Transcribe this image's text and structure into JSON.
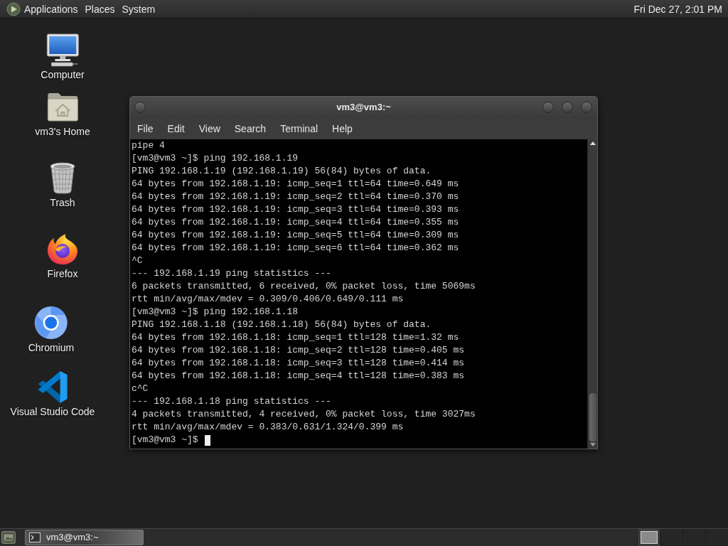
{
  "top_panel": {
    "menus": [
      "Applications",
      "Places",
      "System"
    ],
    "clock": "Fri Dec 27, 2:01 PM"
  },
  "desktop_icons": [
    {
      "kind": "computer",
      "label": "Computer"
    },
    {
      "kind": "home",
      "label": "vm3's Home"
    },
    {
      "kind": "trash",
      "label": "Trash"
    },
    {
      "kind": "firefox",
      "label": "Firefox"
    },
    {
      "kind": "chromium",
      "label": "Chromium"
    },
    {
      "kind": "vscode",
      "label": "Visual Studio Code"
    }
  ],
  "terminal": {
    "title": "vm3@vm3:~",
    "menu": [
      "File",
      "Edit",
      "View",
      "Search",
      "Terminal",
      "Help"
    ],
    "lines": [
      "pipe 4",
      "[vm3@vm3 ~]$ ping 192.168.1.19",
      "PING 192.168.1.19 (192.168.1.19) 56(84) bytes of data.",
      "64 bytes from 192.168.1.19: icmp_seq=1 ttl=64 time=0.649 ms",
      "64 bytes from 192.168.1.19: icmp_seq=2 ttl=64 time=0.370 ms",
      "64 bytes from 192.168.1.19: icmp_seq=3 ttl=64 time=0.393 ms",
      "64 bytes from 192.168.1.19: icmp_seq=4 ttl=64 time=0.355 ms",
      "64 bytes from 192.168.1.19: icmp_seq=5 ttl=64 time=0.309 ms",
      "64 bytes from 192.168.1.19: icmp_seq=6 ttl=64 time=0.362 ms",
      "^C",
      "--- 192.168.1.19 ping statistics ---",
      "6 packets transmitted, 6 received, 0% packet loss, time 5069ms",
      "rtt min/avg/max/mdev = 0.309/0.406/0.649/0.111 ms",
      "[vm3@vm3 ~]$ ping 192.168.1.18",
      "PING 192.168.1.18 (192.168.1.18) 56(84) bytes of data.",
      "64 bytes from 192.168.1.18: icmp_seq=1 ttl=128 time=1.32 ms",
      "64 bytes from 192.168.1.18: icmp_seq=2 ttl=128 time=0.405 ms",
      "64 bytes from 192.168.1.18: icmp_seq=3 ttl=128 time=0.414 ms",
      "64 bytes from 192.168.1.18: icmp_seq=4 ttl=128 time=0.383 ms",
      "c^C",
      "--- 192.168.1.18 ping statistics ---",
      "4 packets transmitted, 4 received, 0% packet loss, time 3027ms",
      "rtt min/avg/max/mdev = 0.383/0.631/1.324/0.399 ms",
      "[vm3@vm3 ~]$"
    ],
    "cursor": true
  },
  "taskbar": {
    "tasks": [
      {
        "label": "vm3@vm3:~",
        "selected": true
      }
    ],
    "workspaces": [
      {
        "selected": true
      },
      {
        "selected": false
      },
      {
        "selected": false
      },
      {
        "selected": false
      }
    ]
  }
}
